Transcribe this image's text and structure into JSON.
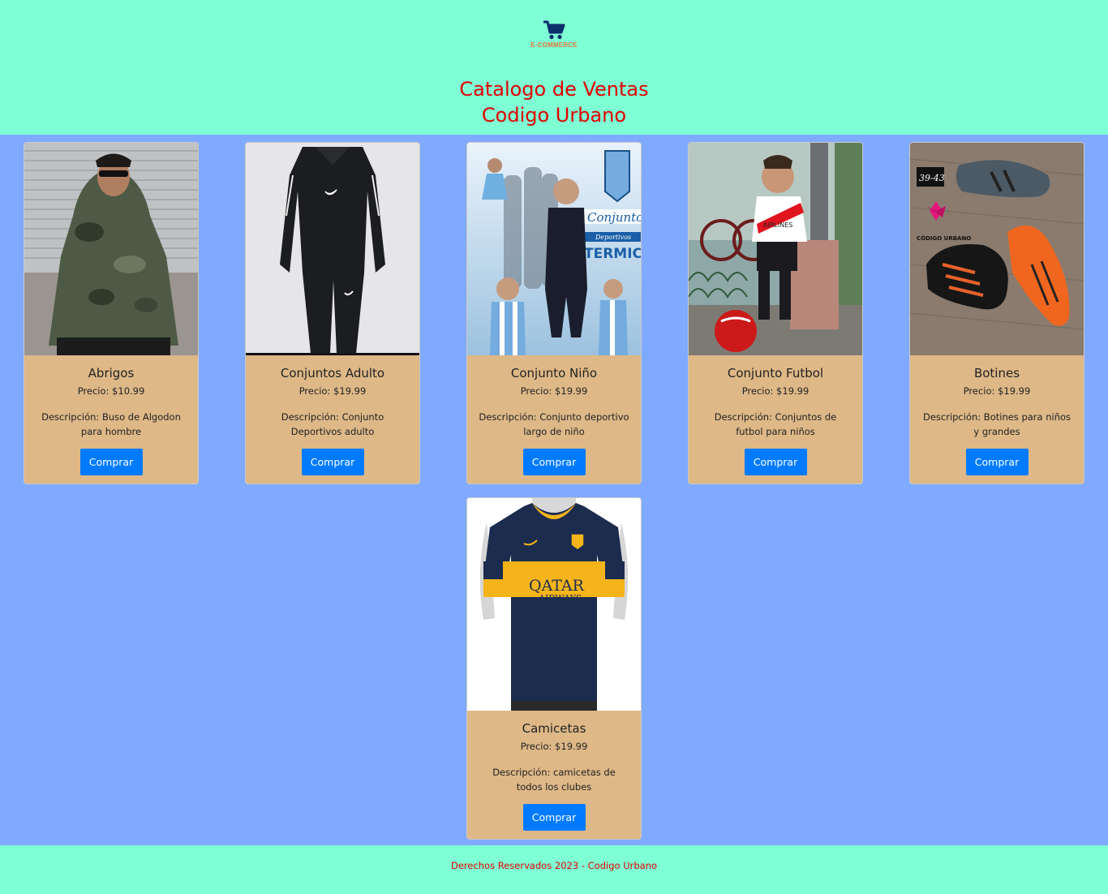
{
  "header": {
    "logo_text": "E-COMMERCE",
    "title_line1": "Catalogo de Ventas",
    "title_line2": "Codigo Urbano"
  },
  "products": [
    {
      "name": "Abrigos",
      "price": "Precio: $10.99",
      "description": "Descripción: Buso de Algodon para hombre",
      "button": "Comprar"
    },
    {
      "name": "Conjuntos Adulto",
      "price": "Precio: $19.99",
      "description": "Descripción: Conjunto Deportivos adulto",
      "button": "Comprar"
    },
    {
      "name": "Conjunto Niño",
      "price": "Precio: $19.99",
      "description": "Descripción: Conjunto deportivo largo de niño",
      "button": "Comprar"
    },
    {
      "name": "Conjunto Futbol",
      "price": "Precio: $19.99",
      "description": "Descripción: Conjuntos de futbol para niños",
      "button": "Comprar"
    },
    {
      "name": "Botines",
      "price": "Precio: $19.99",
      "description": "Descripción: Botines para niños y grandes",
      "button": "Comprar"
    },
    {
      "name": "Camicetas",
      "price": "Precio: $19.99",
      "description": "Descripción: camicetas de todos los clubes",
      "button": "Comprar"
    }
  ],
  "image_text": {
    "kids_banner_1": "Conjuntos",
    "kids_banner_2": "Deportivos",
    "kids_banner_3": "TERMICOS",
    "kids_shirt": "AIRLINES",
    "boots_size": "39-43",
    "boots_brand": "CÓDIGO URBANO",
    "jersey_sponsor_1": "QATAR",
    "jersey_sponsor_2": "AIRWAYS"
  },
  "footer": {
    "text": "Derechos Reservados 2023 - Codigo Urbano"
  },
  "colors": {
    "header_bg": "#7fffd4",
    "page_bg": "#80aaff",
    "card_bg": "#deb887",
    "title": "#e00000",
    "button": "#007bff"
  }
}
